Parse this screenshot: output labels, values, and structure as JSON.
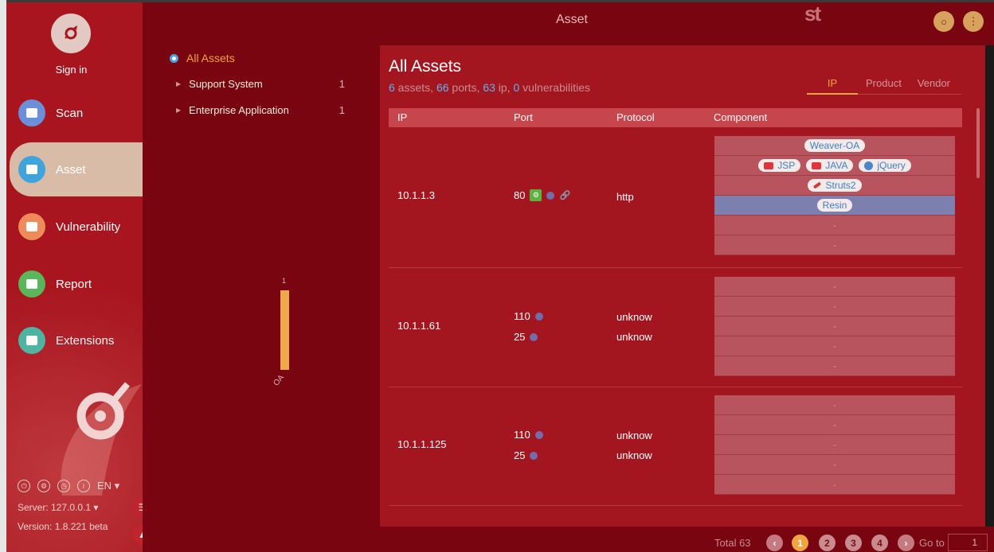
{
  "window": {
    "title": "Asset",
    "logo_text": "st"
  },
  "sidebar": {
    "sign_in": "Sign in",
    "items": [
      {
        "label": "Scan",
        "icon": "scan-icon",
        "color": "#6c8fd9"
      },
      {
        "label": "Asset",
        "icon": "asset-icon",
        "color": "#3fa3dc",
        "active": true
      },
      {
        "label": "Vulnerability",
        "icon": "vulnerability-icon",
        "color": "#ef8a5a"
      },
      {
        "label": "Report",
        "icon": "report-icon",
        "color": "#5ab65a"
      },
      {
        "label": "Extensions",
        "icon": "extensions-icon",
        "color": "#3fb6a2"
      }
    ],
    "language": "EN ▾",
    "server": "Server: 127.0.0.1 ▾",
    "version": "Version: 1.8.221 beta"
  },
  "tree": {
    "root": "All Assets",
    "items": [
      {
        "label": "Support System",
        "count": "1"
      },
      {
        "label": "Enterprise Application",
        "count": "1"
      }
    ],
    "mini_chart": {
      "value": "1",
      "label": "OA"
    }
  },
  "panel": {
    "title": "All Assets",
    "summary": {
      "assets": "6",
      "assets_label": " assets, ",
      "ports": "66",
      "ports_label": " ports, ",
      "ip": "63",
      "ip_label": " ip, ",
      "vulns": "0",
      "vulns_label": " vulnerabilities"
    },
    "view_tabs": [
      "IP",
      "Product",
      "Vendor"
    ],
    "columns": [
      "IP",
      "Port",
      "Protocol",
      "Component"
    ],
    "rows": [
      {
        "ip": "10.1.1.3",
        "ports": [
          {
            "port": "80",
            "protocol": "http"
          }
        ],
        "components": [
          [
            "Weaver-OA"
          ],
          [
            "JSP",
            "JAVA",
            "jQuery"
          ],
          [
            "Struts2"
          ],
          [
            "Resin"
          ],
          [
            "-"
          ],
          [
            "-"
          ]
        ]
      },
      {
        "ip": "10.1.1.61",
        "ports": [
          {
            "port": "110",
            "protocol": "unknow"
          },
          {
            "port": "25",
            "protocol": "unknow"
          }
        ],
        "components": [
          [
            "-"
          ],
          [
            "-"
          ],
          [
            "-"
          ],
          [
            "-"
          ],
          [
            "-"
          ]
        ]
      },
      {
        "ip": "10.1.1.125",
        "ports": [
          {
            "port": "110",
            "protocol": "unknow"
          },
          {
            "port": "25",
            "protocol": "unknow"
          }
        ],
        "components": [
          [
            "-"
          ],
          [
            "-"
          ],
          [
            "-"
          ],
          [
            "-"
          ],
          [
            "-"
          ]
        ]
      }
    ]
  },
  "pagination": {
    "total": "Total 63",
    "pages": [
      "1",
      "2",
      "3",
      "4"
    ],
    "current": "1",
    "goto_label": "Go to",
    "goto_value": "1"
  },
  "colors": {
    "sidebar": "#a8151e",
    "accent": "#f2a440",
    "link": "#5cb2ec",
    "dark": "#78050f"
  }
}
